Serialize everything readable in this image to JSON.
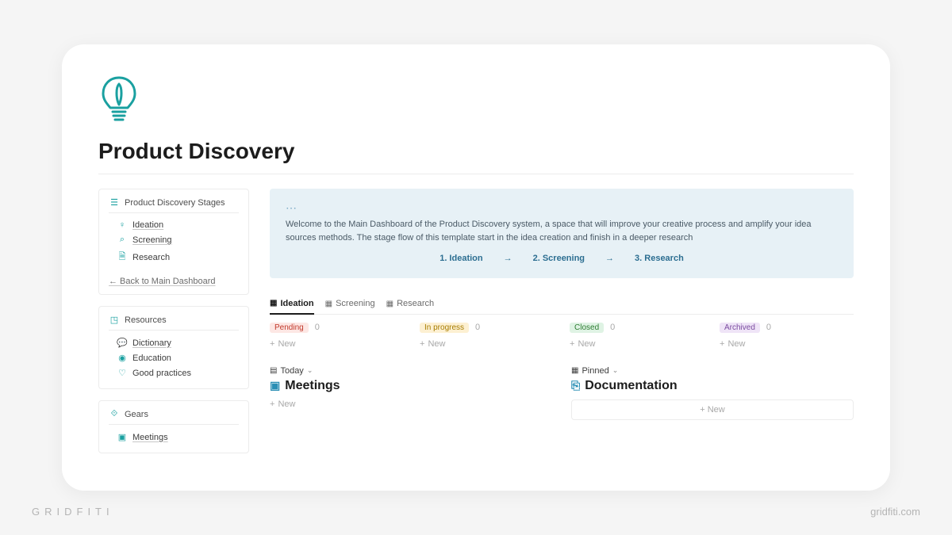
{
  "page": {
    "title": "Product Discovery"
  },
  "sidebar": {
    "stages": {
      "header": "Product Discovery Stages",
      "items": [
        {
          "icon": "lightbulb-icon",
          "label": "Ideation"
        },
        {
          "icon": "magnifier-icon",
          "label": "Screening"
        },
        {
          "icon": "document-icon",
          "label": "Research"
        }
      ],
      "back": "← Back to Main Dashboard"
    },
    "resources": {
      "header": "Resources",
      "items": [
        {
          "icon": "chat-icon",
          "label": "Dictionary"
        },
        {
          "icon": "globe-icon",
          "label": "Education"
        },
        {
          "icon": "heart-icon",
          "label": "Good practices"
        }
      ]
    },
    "gears": {
      "header": "Gears",
      "items": [
        {
          "icon": "meeting-icon",
          "label": "Meetings"
        }
      ]
    }
  },
  "callout": {
    "text": "Welcome to the Main Dashboard of the Product Discovery system, a space that will improve your creative process and amplify your idea sources methods. The stage flow of this template start in the idea creation and finish in a deeper research",
    "flow": [
      "1. Ideation",
      "2. Screening",
      "3. Research"
    ]
  },
  "tabs": [
    "Ideation",
    "Screening",
    "Research"
  ],
  "board": {
    "columns": [
      {
        "label": "Pending",
        "pill": "pill-red",
        "count": "0"
      },
      {
        "label": "In progress",
        "pill": "pill-amber",
        "count": "0"
      },
      {
        "label": "Closed",
        "pill": "pill-green",
        "count": "0"
      },
      {
        "label": "Archived",
        "pill": "pill-purple",
        "count": "0"
      }
    ],
    "new": "New"
  },
  "lower": {
    "left": {
      "view": "Today",
      "title": "Meetings",
      "new": "New"
    },
    "right": {
      "view": "Pinned",
      "title": "Documentation",
      "new": "+ New"
    }
  },
  "watermark": {
    "left": "GRIDFITI",
    "right": "gridfiti.com"
  }
}
